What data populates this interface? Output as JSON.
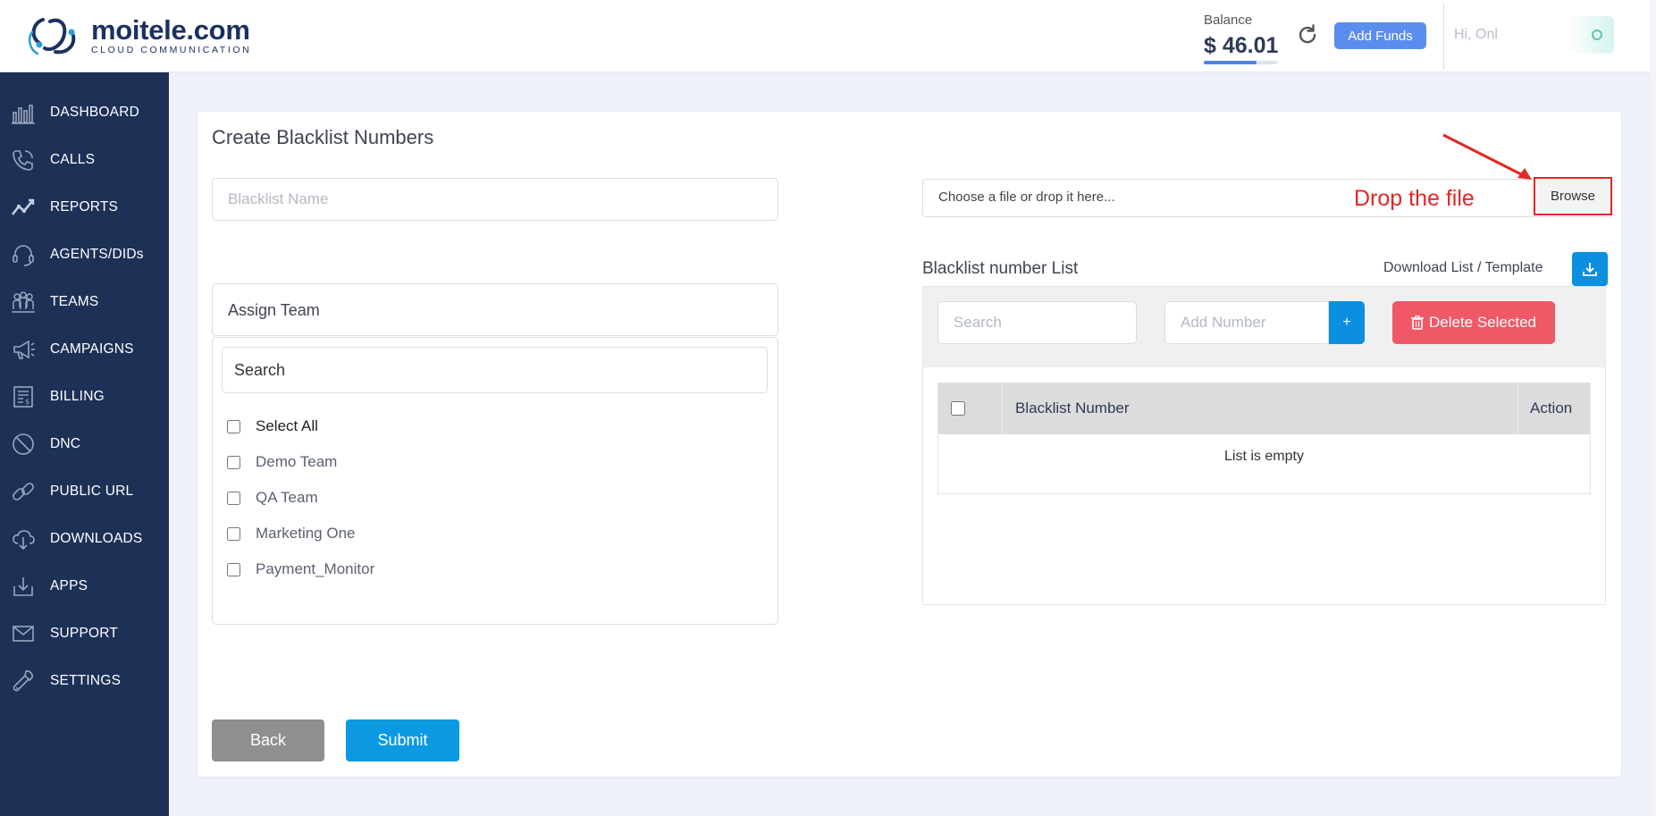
{
  "header": {
    "brand_name": "moitele.com",
    "brand_tagline": "CLOUD COMMUNICATION",
    "balance_label": "Balance",
    "balance_value": "$ 46.01",
    "balance_progress": 0.72,
    "add_funds_label": "Add Funds",
    "greeting": "Hi, Onl"
  },
  "sidebar": {
    "items": [
      {
        "label": "DASHBOARD",
        "icon": "dashboard-icon"
      },
      {
        "label": "CALLS",
        "icon": "phone-icon"
      },
      {
        "label": "REPORTS",
        "icon": "reports-icon"
      },
      {
        "label": "AGENTS/DIDs",
        "icon": "headset-icon"
      },
      {
        "label": "TEAMS",
        "icon": "teams-icon"
      },
      {
        "label": "CAMPAIGNS",
        "icon": "megaphone-icon"
      },
      {
        "label": "BILLING",
        "icon": "billing-icon"
      },
      {
        "label": "DNC",
        "icon": "block-icon"
      },
      {
        "label": "PUBLIC URL",
        "icon": "link-icon"
      },
      {
        "label": "DOWNLOADS",
        "icon": "cloud-download-icon"
      },
      {
        "label": "APPS",
        "icon": "apps-download-icon"
      },
      {
        "label": "SUPPORT",
        "icon": "mail-icon"
      },
      {
        "label": "SETTINGS",
        "icon": "wrench-icon"
      }
    ]
  },
  "form": {
    "title": "Create Blacklist Numbers",
    "blacklist_name_placeholder": "Blacklist Name",
    "assign_team_label": "Assign Team",
    "team_search_placeholder": "Search",
    "select_all_label": "Select All",
    "teams": [
      "Demo Team",
      "QA Team",
      "Marketing One",
      "Payment_Monitor"
    ],
    "back_label": "Back",
    "submit_label": "Submit"
  },
  "upload": {
    "placeholder": "Choose a file or drop it here...",
    "browse_label": "Browse",
    "annotation": "Drop the file"
  },
  "list": {
    "title": "Blacklist number List",
    "download_label": "Download List / Template",
    "search_placeholder": "Search",
    "add_number_placeholder": "Add Number",
    "add_button_label": "+",
    "delete_selected_label": "Delete Selected",
    "columns": [
      "Blacklist Number",
      "Action"
    ],
    "empty_message": "List is empty"
  },
  "colors": {
    "sidebar_bg": "#1d3157",
    "primary": "#0b9ae1",
    "danger": "#ef5866",
    "annotation": "#e32626"
  }
}
